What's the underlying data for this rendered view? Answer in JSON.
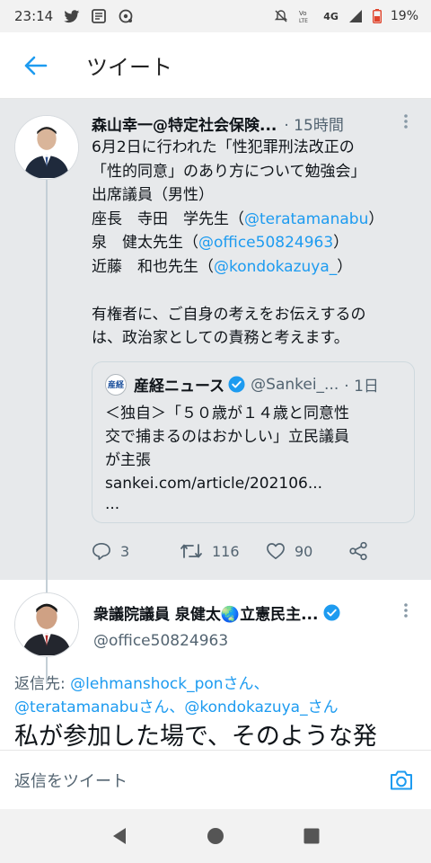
{
  "status_bar": {
    "time": "23:14",
    "network": "4G",
    "battery": "19%",
    "icons": [
      "twitter-icon",
      "news-icon",
      "podcast-icon",
      "mute-icon",
      "volte-icon",
      "signal-icon",
      "battery-icon"
    ]
  },
  "header": {
    "title": "ツイート",
    "back_icon": "arrow-left-icon"
  },
  "parent_tweet": {
    "author": "森山幸一@特定社会保険...",
    "time": "· 15時間",
    "text_lines": [
      {
        "text": "6月2日に行われた「性犯罪刑法改正の",
        "mention": ""
      },
      {
        "text": "「性的同意」のあり方について勉強会」",
        "mention": ""
      },
      {
        "text": "出席議員（男性）",
        "mention": ""
      },
      {
        "text": "座長　寺田　学先生（",
        "mention": "@teratamanabu",
        "after": "）"
      },
      {
        "text": "泉　健太先生（",
        "mention": "@office50824963",
        "after": "）"
      },
      {
        "text": "近藤　和也先生（",
        "mention": "@kondokazuya_",
        "after": "）"
      }
    ],
    "text_lines_2": [
      "有権者に、ご自身の考えをお伝えするの",
      "は、政治家としての責務と考えます。"
    ],
    "quote": {
      "source_name": "産経ニュース",
      "handle": "@Sankei_...",
      "time": "· 1日",
      "logo_text": "産経",
      "text_lines": [
        "＜独自＞「５０歳が１４歳と同意性",
        "交で捕まるのはおかしい」立民議員",
        "が主張",
        "sankei.com/article/202106...",
        "..."
      ]
    },
    "actions": {
      "replies": "3",
      "retweets": "116",
      "likes": "90"
    }
  },
  "reply_tweet": {
    "author": "衆議院議員 泉健太🌏立憲民主...",
    "handle": "@office50824963",
    "replying_label": "返信先: ",
    "replying_line1_mention": "@lehmanshock_ponさん、",
    "replying_line2_mention1": "@teratamanabuさん、",
    "replying_line2_mention2": "@kondokazuya_さん",
    "text": "私が参加した場で、そのような発"
  },
  "compose": {
    "placeholder": "返信をツイート"
  },
  "colors": {
    "accent": "#1d9bf0",
    "parent_bg": "#e7e9eb",
    "verified": "#1d9bf0"
  }
}
